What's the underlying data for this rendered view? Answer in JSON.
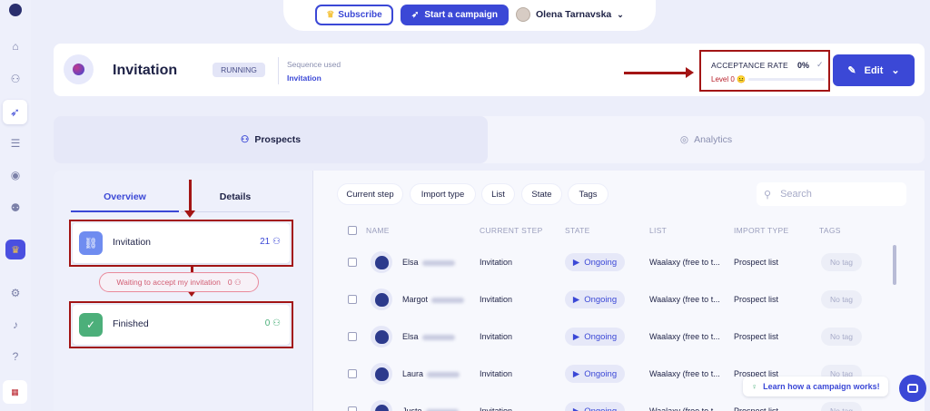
{
  "topbar": {
    "subscribe_label": "Subscribe",
    "campaign_label": "Start a campaign",
    "user_name": "Olena Tarnavska"
  },
  "campaign": {
    "title": "Invitation",
    "status": "RUNNING",
    "sequence_label": "Sequence used",
    "sequence_value": "Invitation",
    "acceptance_label": "ACCEPTANCE RATE",
    "acceptance_value": "0%",
    "level_label": "Level 0 😐",
    "level_progress": 0,
    "edit_label": "Edit"
  },
  "tabs": {
    "prospects": "Prospects",
    "analytics": "Analytics"
  },
  "overview": {
    "tab_overview": "Overview",
    "tab_details": "Details",
    "steps": [
      {
        "label": "Invitation",
        "count": "21"
      },
      {
        "label": "Finished",
        "count": "0"
      }
    ],
    "waiting_label": "Waiting to accept my invitation",
    "waiting_count": "0"
  },
  "filters": [
    "Current step",
    "Import type",
    "List",
    "State",
    "Tags"
  ],
  "search_placeholder": "Search",
  "columns": [
    "NAME",
    "CURRENT STEP",
    "STATE",
    "LIST",
    "IMPORT TYPE",
    "TAGS"
  ],
  "rows": [
    {
      "name": "Elsa",
      "step": "Invitation",
      "state": "Ongoing",
      "list": "Waalaxy (free to t...",
      "import": "Prospect list",
      "tag": "No tag"
    },
    {
      "name": "Margot",
      "step": "Invitation",
      "state": "Ongoing",
      "list": "Waalaxy (free to t...",
      "import": "Prospect list",
      "tag": "No tag"
    },
    {
      "name": "Elsa",
      "step": "Invitation",
      "state": "Ongoing",
      "list": "Waalaxy (free to t...",
      "import": "Prospect list",
      "tag": "No tag"
    },
    {
      "name": "Laura",
      "step": "Invitation",
      "state": "Ongoing",
      "list": "Waalaxy (free to t...",
      "import": "Prospect list",
      "tag": "No tag"
    },
    {
      "name": "Juste",
      "step": "Invitation",
      "state": "Ongoing",
      "list": "Waalaxy (free to t...",
      "import": "Prospect list",
      "tag": "No tag"
    }
  ],
  "learn_label": "Learn how a campaign works!",
  "colors": {
    "accent": "#3b48d6",
    "annotation": "#a31515",
    "invite_step": "#6f8cf0",
    "finished_step": "#4caf7a"
  },
  "icons": [
    "logo-icon",
    "home-icon",
    "users-icon",
    "rocket-icon",
    "list-icon",
    "chat-icon",
    "team-icon",
    "crown-icon",
    "gear-icon",
    "bell-icon",
    "help-icon",
    "flag-icon"
  ]
}
